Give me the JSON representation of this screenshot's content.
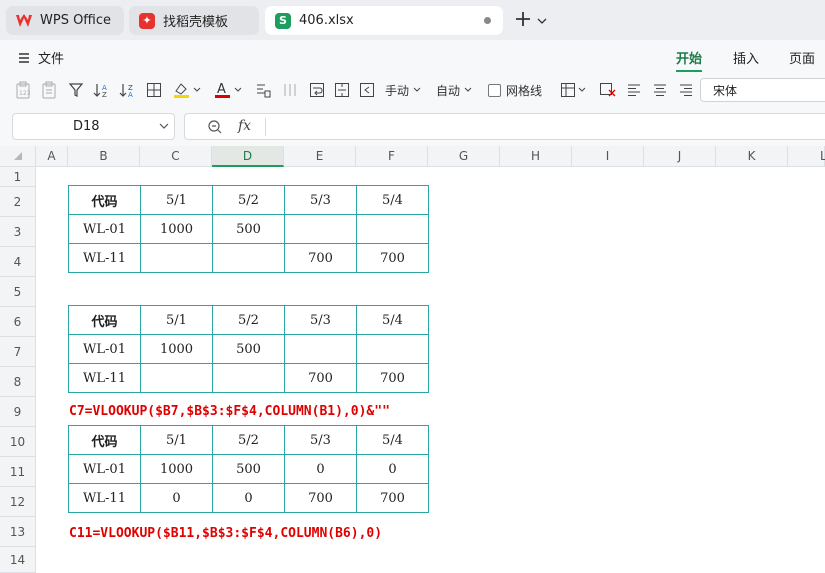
{
  "tabs": {
    "wps": "WPS Office",
    "templates": "找稻壳模板",
    "file": "406.xlsx"
  },
  "menu": {
    "file": "文件",
    "tabs": [
      "开始",
      "插入",
      "页面"
    ]
  },
  "toolbar": {
    "wrap_label": "手动",
    "auto_label": "自动",
    "gridlines_label": "网格线",
    "font_name": "宋体",
    "fill_color": "#f5d800",
    "font_color": "#e00000"
  },
  "formula_bar": {
    "cell_ref": "D18",
    "fx": "fx"
  },
  "columns": [
    "A",
    "B",
    "C",
    "D",
    "E",
    "F",
    "G",
    "H",
    "I",
    "J",
    "K",
    "L"
  ],
  "rows": [
    "1",
    "2",
    "3",
    "4",
    "5",
    "6",
    "7",
    "8",
    "9",
    "10",
    "11",
    "12",
    "13",
    "14"
  ],
  "table1": [
    [
      "代码",
      "5/1",
      "5/2",
      "5/3",
      "5/4"
    ],
    [
      "WL-01",
      "1000",
      "500",
      "",
      ""
    ],
    [
      "WL-11",
      "",
      "",
      "700",
      "700"
    ]
  ],
  "table2": [
    [
      "代码",
      "5/1",
      "5/2",
      "5/3",
      "5/4"
    ],
    [
      "WL-01",
      "1000",
      "500",
      "",
      ""
    ],
    [
      "WL-11",
      "",
      "",
      "700",
      "700"
    ]
  ],
  "formula1": "C7=VLOOKUP($B7,$B$3:$F$4,COLUMN(B1),0)&\"\"",
  "table3": [
    [
      "代码",
      "5/1",
      "5/2",
      "5/3",
      "5/4"
    ],
    [
      "WL-01",
      "1000",
      "500",
      "0",
      "0"
    ],
    [
      "WL-11",
      "0",
      "0",
      "700",
      "700"
    ]
  ],
  "formula2": "C11=VLOOKUP($B11,$B$3:$F$4,COLUMN(B6),0)"
}
